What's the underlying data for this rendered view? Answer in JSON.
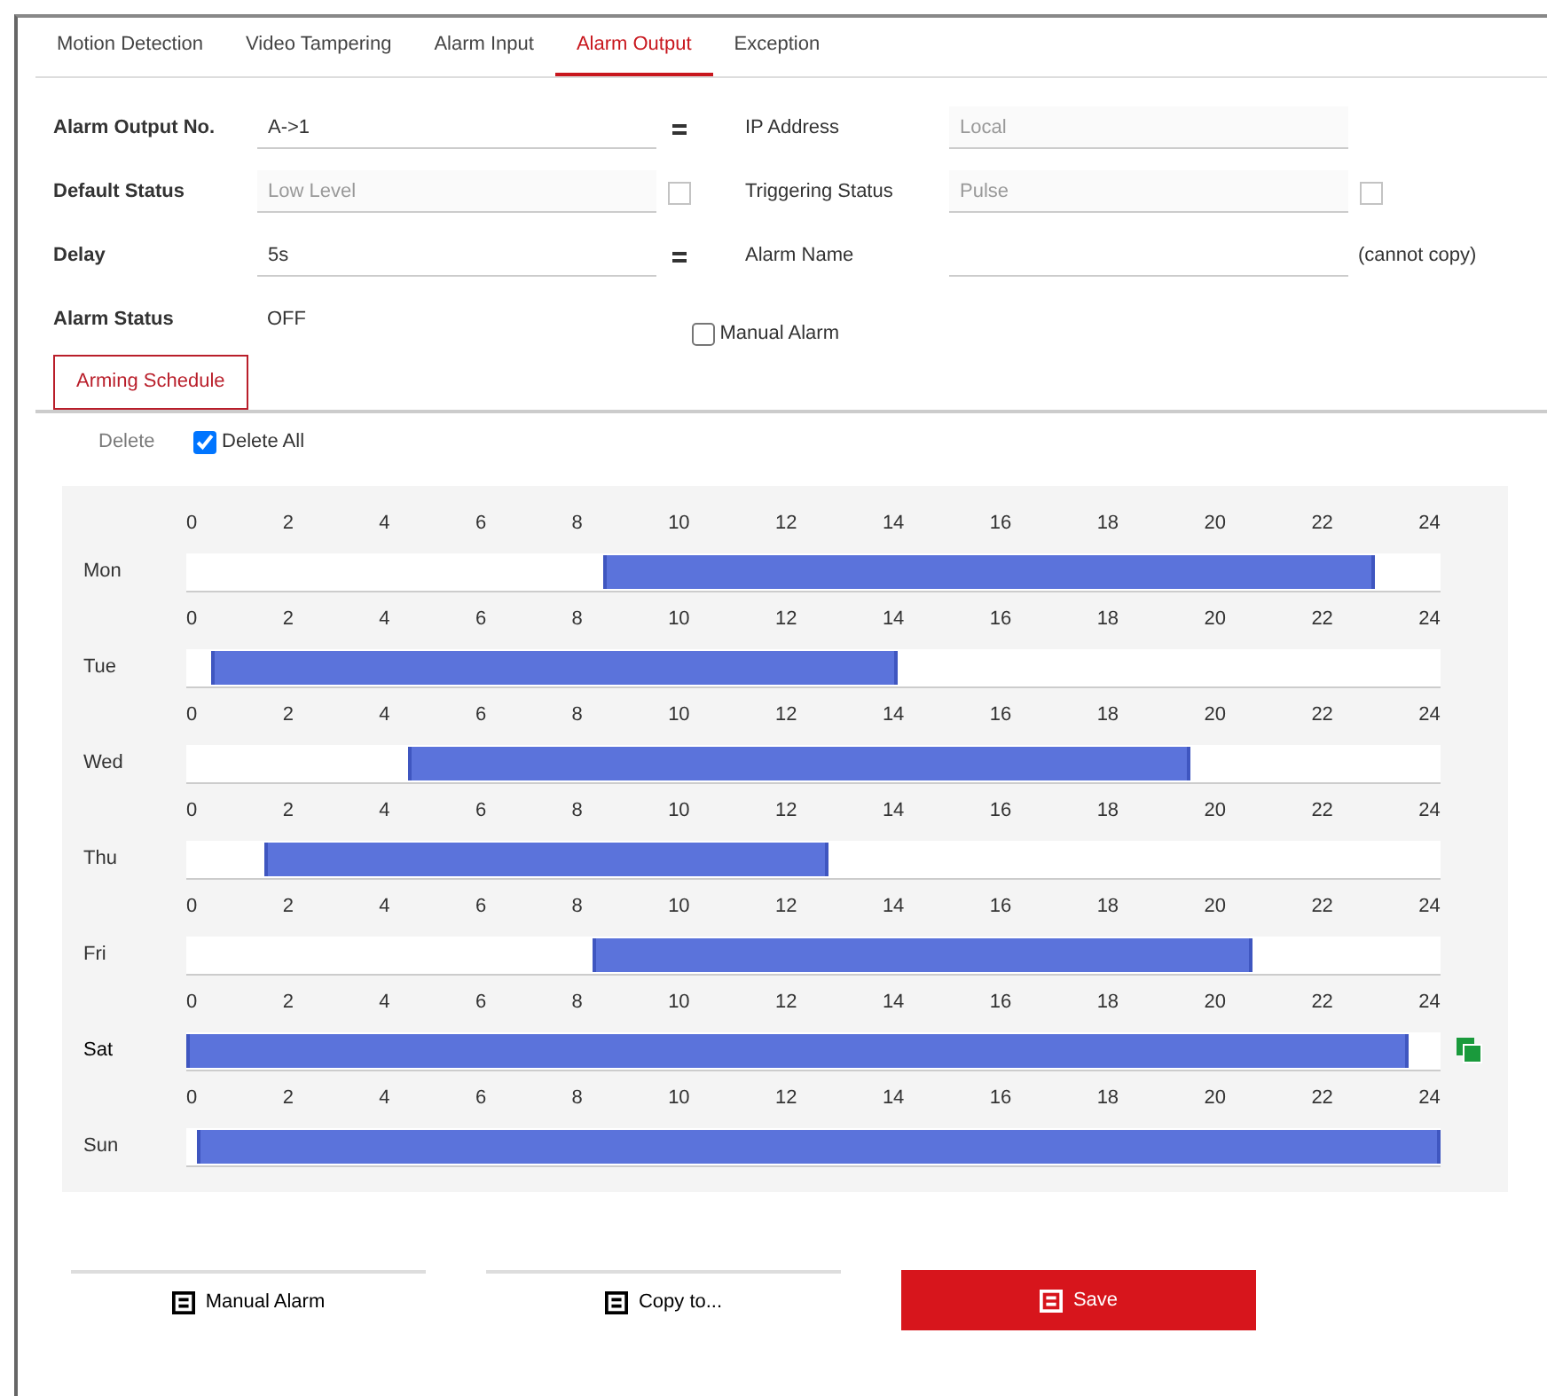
{
  "tabs": [
    {
      "label": "Motion Detection",
      "selected": false
    },
    {
      "label": "Video Tampering",
      "selected": false
    },
    {
      "label": "Alarm Input",
      "selected": false
    },
    {
      "label": "Alarm Output",
      "selected": true
    },
    {
      "label": "Exception",
      "selected": false
    }
  ],
  "form": {
    "left": [
      {
        "label": "Alarm Output No.",
        "value": "A->1",
        "kind": "select",
        "disabled": false
      },
      {
        "label": "Default Status",
        "value": "Low Level",
        "kind": "select",
        "disabled": true
      },
      {
        "label": "Delay",
        "value": "5s",
        "kind": "select",
        "disabled": false
      },
      {
        "label": "Alarm Status",
        "value": "OFF",
        "kind": "text"
      }
    ],
    "right": [
      {
        "label": "IP Address",
        "value": "Local",
        "kind": "input",
        "disabled": true
      },
      {
        "label": "Triggering Status",
        "value": "Pulse",
        "kind": "select",
        "disabled": true
      },
      {
        "label": "Alarm Name",
        "kind": "input",
        "note": "(cannot copy)"
      }
    ],
    "checkbox": {
      "label": "Manual Alarm",
      "checked": false
    }
  },
  "subtab": {
    "label": "Arming Schedule",
    "selected": true
  },
  "schedule_toolbar": {
    "delete": {
      "label": "Delete",
      "disabled": true
    },
    "delete_all": {
      "label": "Delete All",
      "checked": true
    }
  },
  "schedule": {
    "days": [
      {
        "label": "Mon",
        "selected": false,
        "ticks": [
          "0",
          "2",
          "4",
          "6",
          "8",
          "10",
          "12",
          "14",
          "16",
          "18",
          "20",
          "22",
          "24"
        ],
        "range": [
          {
            "level": 0.333
          },
          {
            "level": 0.948
          }
        ]
      },
      {
        "label": "Tue",
        "selected": false,
        "ticks": [
          "0",
          "2",
          "4",
          "6",
          "8",
          "10",
          "12",
          "14",
          "16",
          "18",
          "20",
          "22",
          "24"
        ],
        "range": [
          {
            "level": 0.02
          },
          {
            "level": 0.566
          }
        ]
      },
      {
        "label": "Wed",
        "selected": false,
        "ticks": [
          "0",
          "2",
          "4",
          "6",
          "8",
          "10",
          "12",
          "14",
          "16",
          "18",
          "20",
          "22",
          "24"
        ],
        "range": [
          {
            "level": 0.177
          },
          {
            "level": 0.8
          }
        ]
      },
      {
        "label": "Thu",
        "selected": false,
        "ticks": [
          "0",
          "2",
          "4",
          "6",
          "8",
          "10",
          "12",
          "14",
          "16",
          "18",
          "20",
          "22",
          "24"
        ],
        "range": [
          {
            "level": 0.063
          },
          {
            "level": 0.51
          }
        ]
      },
      {
        "label": "Fri",
        "selected": false,
        "ticks": [
          "0",
          "2",
          "4",
          "6",
          "8",
          "10",
          "12",
          "14",
          "16",
          "18",
          "20",
          "22",
          "24"
        ],
        "range": [
          {
            "level": 0.325
          },
          {
            "level": 0.85
          }
        ]
      },
      {
        "label": "Sat",
        "selected": true,
        "ticks": [
          "0",
          "2",
          "4",
          "6",
          "8",
          "10",
          "12",
          "14",
          "16",
          "18",
          "20",
          "22",
          "24"
        ],
        "range": [
          {
            "level": 0
          },
          {
            "level": 0.975
          }
        ]
      },
      {
        "label": "Sun",
        "selected": false,
        "ticks": [
          "0",
          "2",
          "4",
          "6",
          "8",
          "10",
          "12",
          "14",
          "16",
          "18",
          "20",
          "22",
          "24"
        ],
        "range": [
          {
            "level": 0.008
          },
          {
            "level": 1
          }
        ]
      }
    ]
  },
  "buttons": [
    {
      "label": "Manual Alarm",
      "kind": "plain"
    },
    {
      "label": "Copy to...",
      "kind": "plain"
    },
    {
      "label": "Save",
      "kind": "primary"
    }
  ]
}
